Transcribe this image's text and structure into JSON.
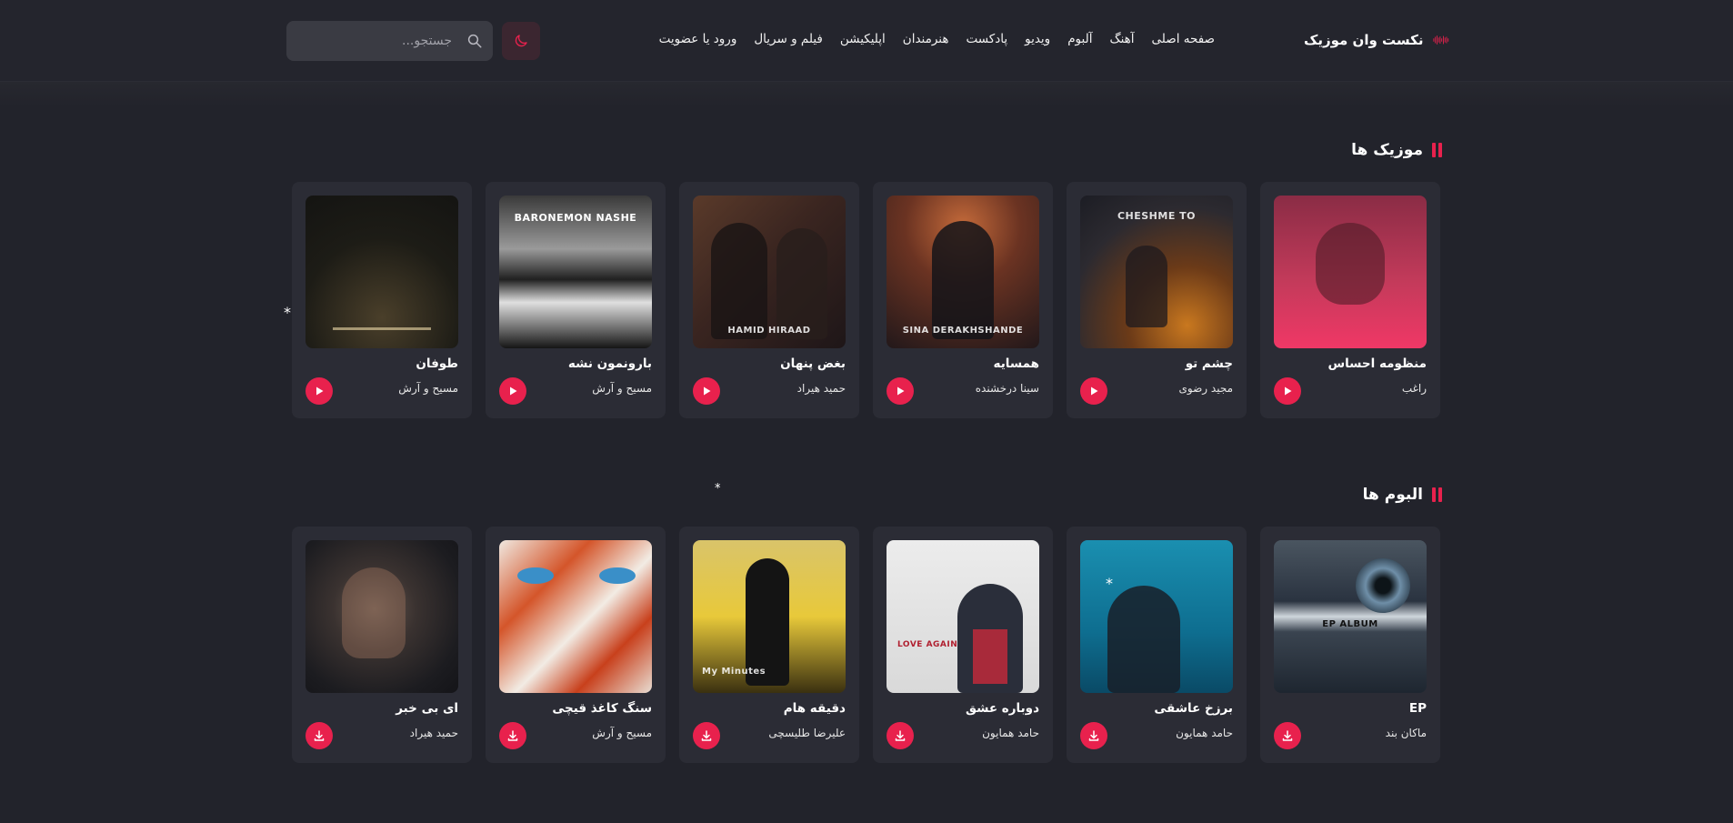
{
  "header": {
    "logo_text": "نکست وان موزیک",
    "nav": [
      "صفحه اصلی",
      "آهنگ",
      "آلبوم",
      "ویدیو",
      "پادکست",
      "هنرمندان",
      "اپلیکیشن",
      "فیلم و سریال",
      "ورود یا عضویت"
    ],
    "search_placeholder": "جستجو..."
  },
  "music_section": {
    "title": "موزیک ها",
    "items": [
      {
        "title": "منظومه احساس",
        "artist": "راغب",
        "cover_text": ""
      },
      {
        "title": "چشم تو",
        "artist": "مجید رضوی",
        "cover_text": "CHESHME TO"
      },
      {
        "title": "همسایه",
        "artist": "سینا درخشنده",
        "cover_text": "SINA DERAKHSHANDE"
      },
      {
        "title": "بغض پنهان",
        "artist": "حمید هیراد",
        "cover_text": "HAMID HIRAAD"
      },
      {
        "title": "بارونمون نشه",
        "artist": "مسیح و آرش",
        "cover_text": "BARONEMON NASHE"
      },
      {
        "title": "طوفان",
        "artist": "مسیح و آرش",
        "cover_text": ""
      }
    ]
  },
  "album_section": {
    "title": "البوم ها",
    "items": [
      {
        "title": "EP",
        "artist": "ماکان بند",
        "cover_text": "EP ALBUM"
      },
      {
        "title": "برزخ عاشقی",
        "artist": "حامد همایون",
        "cover_text": ""
      },
      {
        "title": "دوباره عشق",
        "artist": "حامد همایون",
        "cover_text": "LOVE AGAIN"
      },
      {
        "title": "دقیقه هام",
        "artist": "علیرضا طلیسچی",
        "cover_text": "My Minutes"
      },
      {
        "title": "سنگ کاغذ قیچی",
        "artist": "مسیح و آرش",
        "cover_text": ""
      },
      {
        "title": "ای بی خبر",
        "artist": "حمید هیراد",
        "cover_text": ""
      }
    ]
  },
  "colors": {
    "accent": "#e8214d",
    "background": "#22232b",
    "card": "#2b2c35"
  }
}
